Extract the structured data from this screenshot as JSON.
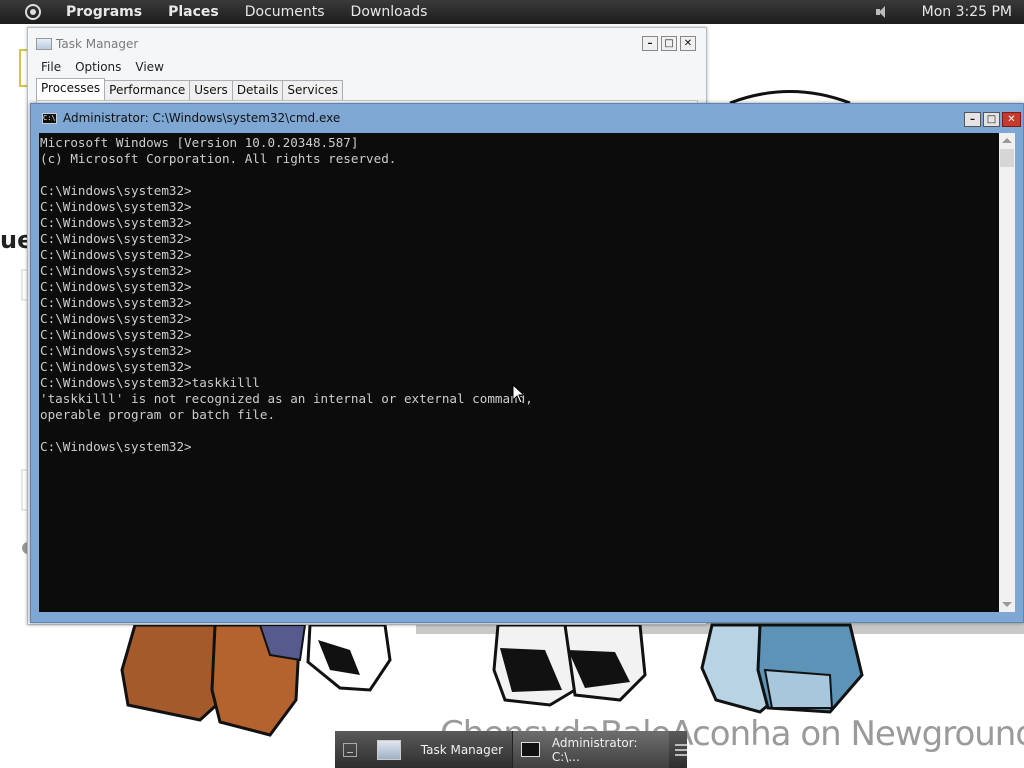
{
  "top_panel": {
    "menus": [
      "Programs",
      "Places",
      "Documents",
      "Downloads"
    ],
    "clock": "Mon  3:25 PM"
  },
  "task_manager": {
    "title": "Task Manager",
    "menu": [
      "File",
      "Options",
      "View"
    ],
    "tabs": [
      "Processes",
      "Performance",
      "Users",
      "Details",
      "Services"
    ],
    "active_tab": "Processes"
  },
  "cmd": {
    "title": "Administrator: C:\\Windows\\system32\\cmd.exe",
    "lines": [
      "Microsoft Windows [Version 10.0.20348.587]",
      "(c) Microsoft Corporation. All rights reserved.",
      "",
      "C:\\Windows\\system32>",
      "C:\\Windows\\system32>",
      "C:\\Windows\\system32>",
      "C:\\Windows\\system32>",
      "C:\\Windows\\system32>",
      "C:\\Windows\\system32>",
      "C:\\Windows\\system32>",
      "C:\\Windows\\system32>",
      "C:\\Windows\\system32>",
      "C:\\Windows\\system32>",
      "C:\\Windows\\system32>",
      "C:\\Windows\\system32>",
      "C:\\Windows\\system32>taskkilll",
      "'taskkilll' is not recognized as an internal or external command,",
      "operable program or batch file.",
      "",
      "C:\\Windows\\system32>"
    ]
  },
  "taskbar": {
    "items": [
      "Task Manager",
      "Administrator: C:\\..."
    ]
  },
  "background": {
    "fragment_text": "ue",
    "watermark": "ChensydaBaloAconha on Newgrounds."
  }
}
